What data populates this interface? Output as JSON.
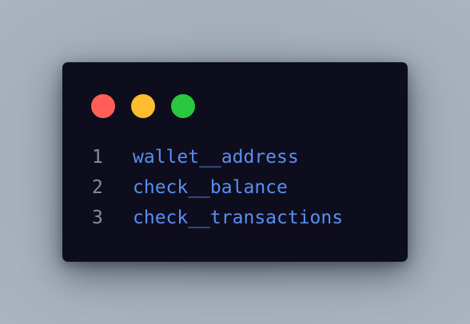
{
  "window": {
    "controls": [
      {
        "name": "close",
        "color": "#ff5f57"
      },
      {
        "name": "minimize",
        "color": "#febc2e"
      },
      {
        "name": "maximize",
        "color": "#28c840"
      }
    ]
  },
  "code": {
    "text_color": "#5a8ef0",
    "line_number_color": "#8a8d99",
    "lines": [
      {
        "number": "1",
        "text": "wallet__address"
      },
      {
        "number": "2",
        "text": "check__balance"
      },
      {
        "number": "3",
        "text": "check__transactions"
      }
    ]
  }
}
